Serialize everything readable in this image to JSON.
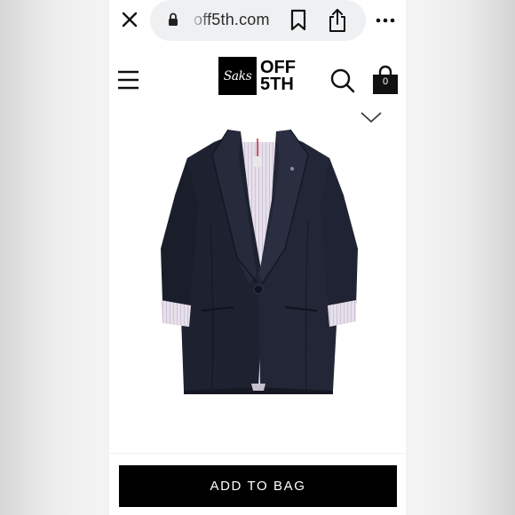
{
  "browser": {
    "url": "off5th.com",
    "icons": [
      "close-icon",
      "lock-icon",
      "bookmark-icon",
      "share-icon",
      "more-icon"
    ]
  },
  "header": {
    "logo_script": "Saks",
    "logo_line1": "OFF",
    "logo_line2": "5TH",
    "bag_count": "0",
    "icons": [
      "menu-icon",
      "search-icon",
      "shopping-bag-icon",
      "chevron-down-icon"
    ]
  },
  "product": {
    "image_alt": "navy blazer product image"
  },
  "cta": {
    "add_to_bag_label": "ADD TO BAG"
  },
  "colors": {
    "primary": "#000000",
    "background": "#ffffff",
    "url_pill": "#eef0f2",
    "blazer": "#1d2130"
  }
}
